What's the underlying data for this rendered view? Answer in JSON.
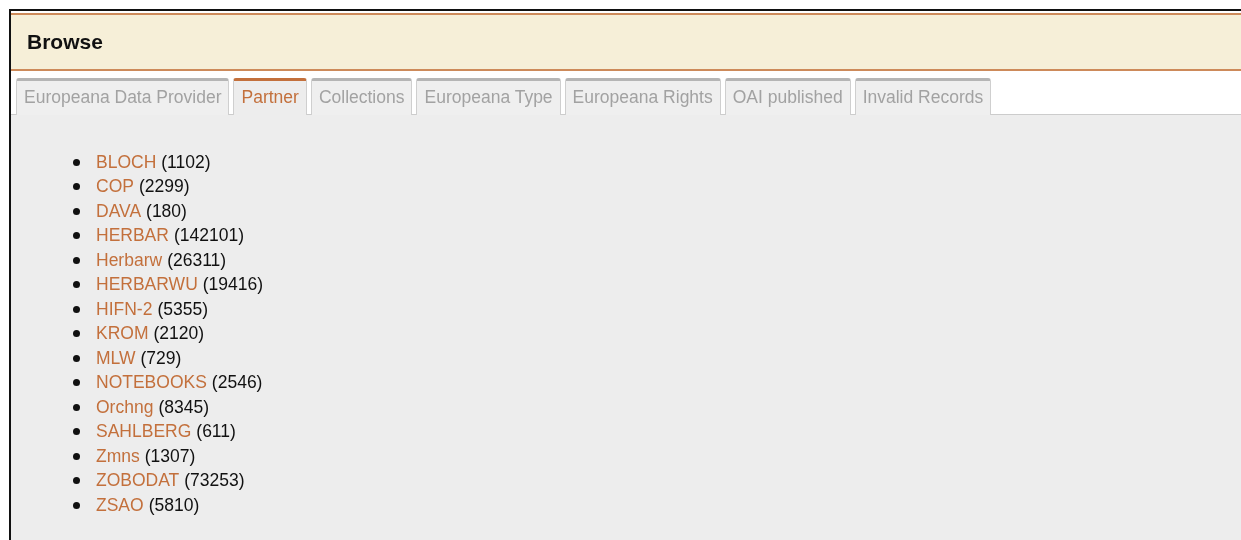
{
  "title": "Browse",
  "tabs": [
    {
      "label": "Europeana Data Provider",
      "selected": false
    },
    {
      "label": "Partner",
      "selected": true
    },
    {
      "label": "Collections",
      "selected": false
    },
    {
      "label": "Europeana Type",
      "selected": false
    },
    {
      "label": "Europeana Rights",
      "selected": false
    },
    {
      "label": "OAI published",
      "selected": false
    },
    {
      "label": "Invalid Records",
      "selected": false
    }
  ],
  "items": [
    {
      "name": "BLOCH",
      "count": "(1102)"
    },
    {
      "name": "COP",
      "count": "(2299)"
    },
    {
      "name": "DAVA",
      "count": "(180)"
    },
    {
      "name": "HERBAR",
      "count": "(142101)"
    },
    {
      "name": "Herbarw",
      "count": "(26311)"
    },
    {
      "name": "HERBARWU",
      "count": "(19416)"
    },
    {
      "name": "HIFN-2",
      "count": "(5355)"
    },
    {
      "name": "KROM",
      "count": "(2120)"
    },
    {
      "name": "MLW",
      "count": "(729)"
    },
    {
      "name": "NOTEBOOKS",
      "count": "(2546)"
    },
    {
      "name": "Orchng",
      "count": "(8345)"
    },
    {
      "name": "SAHLBERG",
      "count": "(611)"
    },
    {
      "name": "Zmns",
      "count": "(1307)"
    },
    {
      "name": "ZOBODAT",
      "count": "(73253)"
    },
    {
      "name": "ZSAO",
      "count": "(5810)"
    }
  ]
}
